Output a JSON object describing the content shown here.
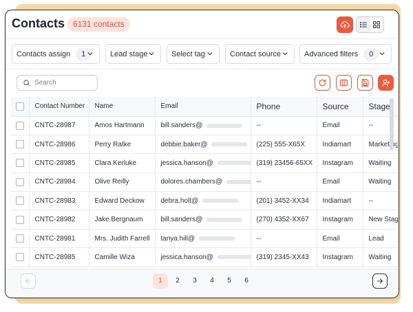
{
  "header": {
    "title": "Contacts",
    "count_label": "6131 contacts"
  },
  "filters": [
    {
      "label": "Contacts assign",
      "count": "1"
    },
    {
      "label": "Lead stage"
    },
    {
      "label": "Select tag"
    },
    {
      "label": "Contact source"
    },
    {
      "label": "Advanced filters",
      "count": "0"
    }
  ],
  "search": {
    "placeholder": "Search"
  },
  "table": {
    "columns": [
      "Contact Number",
      "Name",
      "Email",
      "Phone",
      "Source",
      "Stage"
    ],
    "rows": [
      {
        "number": "CNTC-28987",
        "name": "Amos Hartmann",
        "email": "bill.sanders@",
        "phone": "--",
        "source": "Email",
        "stage": "--"
      },
      {
        "number": "CNTC-28986",
        "name": "Perry Ratke",
        "email": "debbie.baker@",
        "phone": "(225) 555-X65X",
        "source": "Indiamart",
        "stage": "Marketing C"
      },
      {
        "number": "CNTC-28985",
        "name": "Clara Kerluke",
        "email": "jessica.hanson@",
        "phone": "(319) 23456-65XX",
        "source": "Instagram",
        "stage": "Waiting"
      },
      {
        "number": "CNTC-28984",
        "name": "Olive Reilly",
        "email": "dolores.chambers@",
        "phone": "--",
        "source": "Email",
        "stage": "Waiting"
      },
      {
        "number": "CNTC-28983",
        "name": "Edward Deckow",
        "email": "debra.holt@",
        "phone": "(201) 3452-XX34",
        "source": "Indiamart",
        "stage": "--"
      },
      {
        "number": "CNTC-28982",
        "name": "Jake Bergnaum",
        "email": "bill.sanders@",
        "phone": "(270) 4352-XX67",
        "source": "Instagram",
        "stage": "New Stage"
      },
      {
        "number": "CNTC-28981",
        "name": "Mrs. Judith Farrell",
        "email": "tanya.hill@",
        "phone": "--",
        "source": "Email",
        "stage": "Lead"
      },
      {
        "number": "CNTC-28985",
        "name": "Camille Wiza",
        "email": "jessica.hanson@",
        "phone": "(319) 2345-XX43",
        "source": "Instagram",
        "stage": "Waiting"
      }
    ]
  },
  "pagination": {
    "pages": [
      "1",
      "2",
      "3",
      "4",
      "5",
      "6"
    ],
    "current": "1"
  },
  "colors": {
    "accent": "#ef5a3c",
    "accent_soft": "#fde3dd",
    "backdrop": "#f6d7a6"
  }
}
